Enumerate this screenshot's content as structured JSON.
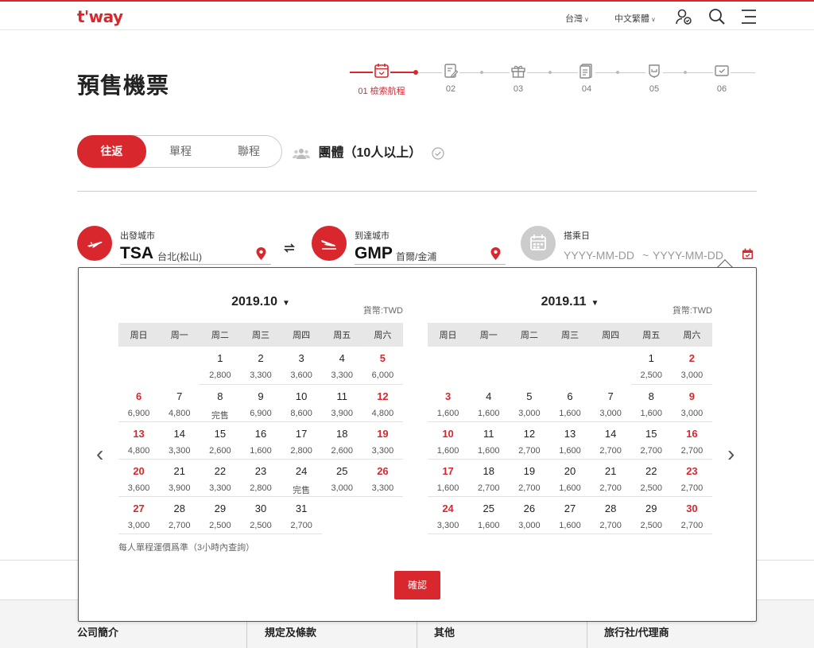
{
  "header": {
    "logo": "t'way",
    "region": "台灣",
    "language": "中文繁體"
  },
  "page": {
    "title": "預售機票"
  },
  "steps": [
    {
      "label": "01 檢索航程",
      "active": true,
      "icon": "calendar-icon"
    },
    {
      "label": "02",
      "active": false,
      "icon": "edit-icon"
    },
    {
      "label": "03",
      "active": false,
      "icon": "gift-icon"
    },
    {
      "label": "04",
      "active": false,
      "icon": "document-icon"
    },
    {
      "label": "05",
      "active": false,
      "icon": "seat-icon"
    },
    {
      "label": "06",
      "active": false,
      "icon": "ticket-icon"
    }
  ],
  "trip_types": [
    "往返",
    "單程",
    "聯程"
  ],
  "group": {
    "label": "團體（10人以上）"
  },
  "departure": {
    "label": "出發城市",
    "code": "TSA",
    "name": "台北(松山)"
  },
  "arrival": {
    "label": "到達城市",
    "code": "GMP",
    "name": "首爾/金浦"
  },
  "date": {
    "label": "搭乘日",
    "start_placeholder": "YYYY-MM-DD",
    "separator": "~",
    "end_placeholder": "YYYY-MM-DD"
  },
  "calendar": {
    "weekdays": [
      "周日",
      "周一",
      "周二",
      "周三",
      "周四",
      "周五",
      "周六"
    ],
    "currency": "貨幣:TWD",
    "note": "每人單程運價爲準（3小時內查詢）",
    "confirm": "確認",
    "months": [
      {
        "title": "2019.10",
        "weeks": [
          [
            null,
            null,
            {
              "d": "1",
              "p": "2,800"
            },
            {
              "d": "2",
              "p": "3,300"
            },
            {
              "d": "3",
              "p": "3,600"
            },
            {
              "d": "4",
              "p": "3,300"
            },
            {
              "d": "5",
              "p": "6,000"
            }
          ],
          [
            {
              "d": "6",
              "p": "6,900"
            },
            {
              "d": "7",
              "p": "4,800"
            },
            {
              "d": "8",
              "p": "完售"
            },
            {
              "d": "9",
              "p": "6,900"
            },
            {
              "d": "10",
              "p": "8,600"
            },
            {
              "d": "11",
              "p": "3,900"
            },
            {
              "d": "12",
              "p": "4,800"
            }
          ],
          [
            {
              "d": "13",
              "p": "4,800"
            },
            {
              "d": "14",
              "p": "3,300"
            },
            {
              "d": "15",
              "p": "2,600"
            },
            {
              "d": "16",
              "p": "1,600"
            },
            {
              "d": "17",
              "p": "2,800"
            },
            {
              "d": "18",
              "p": "2,600"
            },
            {
              "d": "19",
              "p": "3,300"
            }
          ],
          [
            {
              "d": "20",
              "p": "3,600"
            },
            {
              "d": "21",
              "p": "3,900"
            },
            {
              "d": "22",
              "p": "3,300"
            },
            {
              "d": "23",
              "p": "2,800"
            },
            {
              "d": "24",
              "p": "完售"
            },
            {
              "d": "25",
              "p": "3,000"
            },
            {
              "d": "26",
              "p": "3,300"
            }
          ],
          [
            {
              "d": "27",
              "p": "3,000"
            },
            {
              "d": "28",
              "p": "2,700"
            },
            {
              "d": "29",
              "p": "2,500"
            },
            {
              "d": "30",
              "p": "2,500"
            },
            {
              "d": "31",
              "p": "2,700"
            },
            "blank",
            "blank"
          ]
        ]
      },
      {
        "title": "2019.11",
        "weeks": [
          [
            null,
            null,
            null,
            null,
            null,
            {
              "d": "1",
              "p": "2,500"
            },
            {
              "d": "2",
              "p": "3,000"
            }
          ],
          [
            {
              "d": "3",
              "p": "1,600"
            },
            {
              "d": "4",
              "p": "1,600"
            },
            {
              "d": "5",
              "p": "3,000"
            },
            {
              "d": "6",
              "p": "1,600"
            },
            {
              "d": "7",
              "p": "3,000"
            },
            {
              "d": "8",
              "p": "1,600"
            },
            {
              "d": "9",
              "p": "3,000"
            }
          ],
          [
            {
              "d": "10",
              "p": "1,600"
            },
            {
              "d": "11",
              "p": "1,600"
            },
            {
              "d": "12",
              "p": "2,700"
            },
            {
              "d": "13",
              "p": "1,600"
            },
            {
              "d": "14",
              "p": "2,700"
            },
            {
              "d": "15",
              "p": "2,700"
            },
            {
              "d": "16",
              "p": "2,700"
            }
          ],
          [
            {
              "d": "17",
              "p": "1,600"
            },
            {
              "d": "18",
              "p": "2,700"
            },
            {
              "d": "19",
              "p": "2,700"
            },
            {
              "d": "20",
              "p": "1,600"
            },
            {
              "d": "21",
              "p": "2,700"
            },
            {
              "d": "22",
              "p": "2,500"
            },
            {
              "d": "23",
              "p": "2,700"
            }
          ],
          [
            {
              "d": "24",
              "p": "3,300"
            },
            {
              "d": "25",
              "p": "1,600"
            },
            {
              "d": "26",
              "p": "3,000"
            },
            {
              "d": "27",
              "p": "1,600"
            },
            {
              "d": "28",
              "p": "2,700"
            },
            {
              "d": "29",
              "p": "2,500"
            },
            {
              "d": "30",
              "p": "2,700"
            }
          ]
        ]
      }
    ]
  },
  "footer": [
    "公司簡介",
    "規定及條款",
    "其他",
    "旅行社/代理商"
  ],
  "colors": {
    "accent": "#d9272e",
    "muted": "#cccccc"
  }
}
